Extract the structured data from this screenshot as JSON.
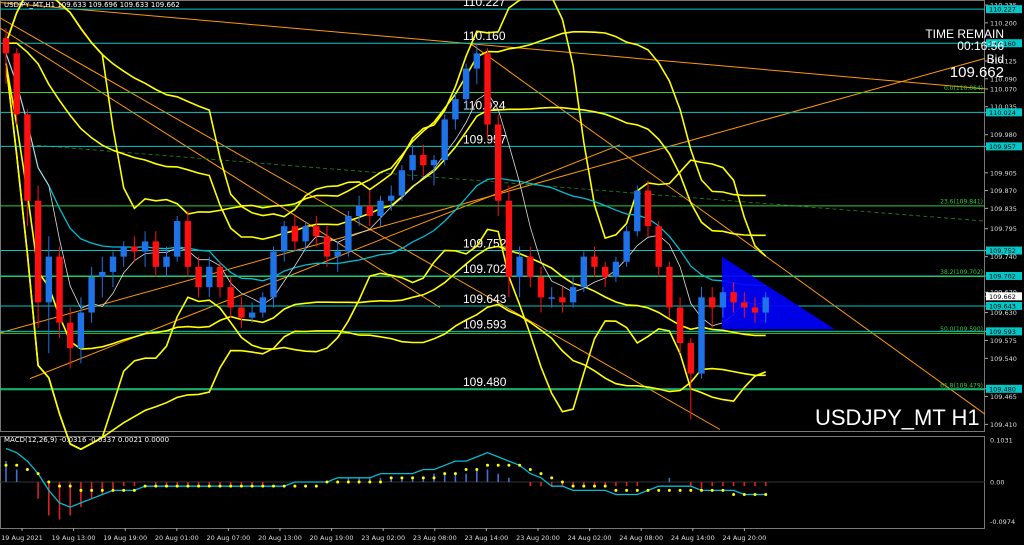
{
  "header": {
    "symbol_line": "USDJPY_MT,H1  109.633 109.696 109.633 109.662",
    "macd_label": "MACD(12,26,9) -0.0316 -0.0337 0.0021 0.0000"
  },
  "info_panel": {
    "time_label": "TIME REMAIN",
    "time_value": "00:16:56",
    "bid_label": "Bid",
    "bid_value": "109.662"
  },
  "watermark": "USDJPY_MT H1",
  "colors": {
    "background": "#000000",
    "bull": "#1e73e8",
    "bear": "#ff1010",
    "band": "#ffff00",
    "hline": "#00c8c8",
    "trend": "#ff9900",
    "fib": "#32cd32",
    "triangle": "#0000ff"
  },
  "chart_data": {
    "type": "candlestick",
    "symbol": "USDJPY_MT",
    "timeframe": "H1",
    "ylim": [
      109.395,
      110.245
    ],
    "y_ticks": [
      "110.235",
      "110.200",
      "110.160",
      "110.125",
      "110.090",
      "110.070",
      "110.035",
      "110.024",
      "109.980",
      "109.957",
      "109.905",
      "109.870",
      "109.835",
      "109.795",
      "109.752",
      "109.740",
      "109.702",
      "109.670",
      "109.662",
      "109.643",
      "109.630",
      "109.593",
      "109.575",
      "109.540",
      "109.480",
      "109.465",
      "109.410"
    ],
    "x_ticks": [
      "19 Aug 2021",
      "19 Aug 13:00",
      "19 Aug 19:00",
      "20 Aug 01:00",
      "20 Aug 07:00",
      "20 Aug 13:00",
      "20 Aug 19:00",
      "23 Aug 02:00",
      "23 Aug 08:00",
      "23 Aug 14:00",
      "23 Aug 20:00",
      "24 Aug 02:00",
      "24 Aug 08:00",
      "24 Aug 14:00",
      "24 Aug 20:00"
    ],
    "horizontal_levels": [
      {
        "price": 110.227,
        "label": "110.227"
      },
      {
        "price": 110.16,
        "label": "110.160"
      },
      {
        "price": 110.024,
        "label": "110.024"
      },
      {
        "price": 109.957,
        "label": "109.957"
      },
      {
        "price": 109.752,
        "label": "109.752"
      },
      {
        "price": 109.702,
        "label": "109.702"
      },
      {
        "price": 109.643,
        "label": "109.643"
      },
      {
        "price": 109.593,
        "label": "109.593"
      },
      {
        "price": 109.48,
        "label": "109.480"
      }
    ],
    "fib_levels": [
      {
        "price": 110.064,
        "label": "0.0(110.064)"
      },
      {
        "price": 109.841,
        "label": "23.6(109.841)"
      },
      {
        "price": 109.702,
        "label": "38.2(109.702)"
      },
      {
        "price": 109.59,
        "label": "50.0(109.590)"
      },
      {
        "price": 109.479,
        "label": "61.8(109.479)"
      }
    ],
    "price_badges": [
      "110.227",
      "110.160",
      "110.024",
      "109.957",
      "109.752",
      "109.702",
      "109.662",
      "109.643",
      "109.593",
      "109.480"
    ],
    "current_price": 109.662,
    "candles": [
      {
        "o": 110.17,
        "h": 110.19,
        "l": 110.08,
        "c": 110.14
      },
      {
        "o": 110.14,
        "h": 110.15,
        "l": 110.0,
        "c": 110.02
      },
      {
        "o": 110.02,
        "h": 110.03,
        "l": 109.8,
        "c": 109.85
      },
      {
        "o": 109.85,
        "h": 109.88,
        "l": 109.6,
        "c": 109.65
      },
      {
        "o": 109.65,
        "h": 109.78,
        "l": 109.55,
        "c": 109.74
      },
      {
        "o": 109.74,
        "h": 109.76,
        "l": 109.58,
        "c": 109.61
      },
      {
        "o": 109.61,
        "h": 109.64,
        "l": 109.52,
        "c": 109.56
      },
      {
        "o": 109.56,
        "h": 109.66,
        "l": 109.53,
        "c": 109.63
      },
      {
        "o": 109.63,
        "h": 109.72,
        "l": 109.61,
        "c": 109.7
      },
      {
        "o": 109.7,
        "h": 109.74,
        "l": 109.66,
        "c": 109.71
      },
      {
        "o": 109.71,
        "h": 109.75,
        "l": 109.68,
        "c": 109.74
      },
      {
        "o": 109.74,
        "h": 109.77,
        "l": 109.72,
        "c": 109.76
      },
      {
        "o": 109.76,
        "h": 109.78,
        "l": 109.73,
        "c": 109.75
      },
      {
        "o": 109.75,
        "h": 109.79,
        "l": 109.72,
        "c": 109.77
      },
      {
        "o": 109.77,
        "h": 109.79,
        "l": 109.7,
        "c": 109.72
      },
      {
        "o": 109.72,
        "h": 109.76,
        "l": 109.7,
        "c": 109.74
      },
      {
        "o": 109.74,
        "h": 109.82,
        "l": 109.73,
        "c": 109.81
      },
      {
        "o": 109.81,
        "h": 109.83,
        "l": 109.7,
        "c": 109.72
      },
      {
        "o": 109.72,
        "h": 109.74,
        "l": 109.66,
        "c": 109.68
      },
      {
        "o": 109.68,
        "h": 109.74,
        "l": 109.66,
        "c": 109.72
      },
      {
        "o": 109.72,
        "h": 109.73,
        "l": 109.66,
        "c": 109.68
      },
      {
        "o": 109.68,
        "h": 109.7,
        "l": 109.62,
        "c": 109.64
      },
      {
        "o": 109.64,
        "h": 109.66,
        "l": 109.6,
        "c": 109.62
      },
      {
        "o": 109.62,
        "h": 109.65,
        "l": 109.61,
        "c": 109.63
      },
      {
        "o": 109.63,
        "h": 109.67,
        "l": 109.62,
        "c": 109.66
      },
      {
        "o": 109.66,
        "h": 109.76,
        "l": 109.64,
        "c": 109.75
      },
      {
        "o": 109.75,
        "h": 109.81,
        "l": 109.73,
        "c": 109.8
      },
      {
        "o": 109.8,
        "h": 109.82,
        "l": 109.75,
        "c": 109.77
      },
      {
        "o": 109.77,
        "h": 109.81,
        "l": 109.75,
        "c": 109.8
      },
      {
        "o": 109.8,
        "h": 109.82,
        "l": 109.76,
        "c": 109.78
      },
      {
        "o": 109.78,
        "h": 109.8,
        "l": 109.72,
        "c": 109.74
      },
      {
        "o": 109.74,
        "h": 109.77,
        "l": 109.71,
        "c": 109.75
      },
      {
        "o": 109.75,
        "h": 109.83,
        "l": 109.74,
        "c": 109.82
      },
      {
        "o": 109.82,
        "h": 109.86,
        "l": 109.8,
        "c": 109.84
      },
      {
        "o": 109.84,
        "h": 109.87,
        "l": 109.8,
        "c": 109.82
      },
      {
        "o": 109.82,
        "h": 109.86,
        "l": 109.8,
        "c": 109.85
      },
      {
        "o": 109.85,
        "h": 109.88,
        "l": 109.83,
        "c": 109.86
      },
      {
        "o": 109.86,
        "h": 109.92,
        "l": 109.85,
        "c": 109.91
      },
      {
        "o": 109.91,
        "h": 109.96,
        "l": 109.89,
        "c": 109.94
      },
      {
        "o": 109.94,
        "h": 109.96,
        "l": 109.9,
        "c": 109.92
      },
      {
        "o": 109.92,
        "h": 109.94,
        "l": 109.88,
        "c": 109.93
      },
      {
        "o": 109.93,
        "h": 110.02,
        "l": 109.92,
        "c": 110.01
      },
      {
        "o": 110.01,
        "h": 110.06,
        "l": 109.99,
        "c": 110.05
      },
      {
        "o": 110.05,
        "h": 110.12,
        "l": 110.03,
        "c": 110.11
      },
      {
        "o": 110.11,
        "h": 110.16,
        "l": 110.08,
        "c": 110.14
      },
      {
        "o": 110.14,
        "h": 110.15,
        "l": 109.97,
        "c": 110.0
      },
      {
        "o": 110.0,
        "h": 110.02,
        "l": 109.82,
        "c": 109.85
      },
      {
        "o": 109.85,
        "h": 109.88,
        "l": 109.66,
        "c": 109.7
      },
      {
        "o": 109.7,
        "h": 109.76,
        "l": 109.66,
        "c": 109.74
      },
      {
        "o": 109.74,
        "h": 109.76,
        "l": 109.68,
        "c": 109.7
      },
      {
        "o": 109.7,
        "h": 109.72,
        "l": 109.63,
        "c": 109.66
      },
      {
        "o": 109.66,
        "h": 109.68,
        "l": 109.64,
        "c": 109.66
      },
      {
        "o": 109.66,
        "h": 109.68,
        "l": 109.63,
        "c": 109.65
      },
      {
        "o": 109.65,
        "h": 109.7,
        "l": 109.64,
        "c": 109.68
      },
      {
        "o": 109.68,
        "h": 109.75,
        "l": 109.67,
        "c": 109.74
      },
      {
        "o": 109.74,
        "h": 109.76,
        "l": 109.7,
        "c": 109.72
      },
      {
        "o": 109.72,
        "h": 109.73,
        "l": 109.68,
        "c": 109.7
      },
      {
        "o": 109.7,
        "h": 109.74,
        "l": 109.69,
        "c": 109.73
      },
      {
        "o": 109.73,
        "h": 109.8,
        "l": 109.72,
        "c": 109.79
      },
      {
        "o": 109.79,
        "h": 109.88,
        "l": 109.78,
        "c": 109.87
      },
      {
        "o": 109.87,
        "h": 109.89,
        "l": 109.78,
        "c": 109.8
      },
      {
        "o": 109.8,
        "h": 109.81,
        "l": 109.7,
        "c": 109.72
      },
      {
        "o": 109.72,
        "h": 109.73,
        "l": 109.62,
        "c": 109.64
      },
      {
        "o": 109.64,
        "h": 109.66,
        "l": 109.55,
        "c": 109.57
      },
      {
        "o": 109.57,
        "h": 109.58,
        "l": 109.42,
        "c": 109.51
      },
      {
        "o": 109.51,
        "h": 109.68,
        "l": 109.5,
        "c": 109.66
      },
      {
        "o": 109.66,
        "h": 109.68,
        "l": 109.6,
        "c": 109.64
      },
      {
        "o": 109.64,
        "h": 109.68,
        "l": 109.62,
        "c": 109.67
      },
      {
        "o": 109.67,
        "h": 109.69,
        "l": 109.63,
        "c": 109.65
      },
      {
        "o": 109.65,
        "h": 109.67,
        "l": 109.62,
        "c": 109.64
      },
      {
        "o": 109.64,
        "h": 109.66,
        "l": 109.61,
        "c": 109.63
      },
      {
        "o": 109.63,
        "h": 109.67,
        "l": 109.61,
        "c": 109.66
      }
    ],
    "macd": {
      "label": "MACD(12,26,9)",
      "values": [
        -0.0316,
        -0.0337,
        0.0021,
        0.0
      ],
      "y_ticks": [
        "0.1031",
        "0.00",
        "-0.0974"
      ],
      "ylim": [
        -0.11,
        0.11
      ],
      "histogram": [
        0.05,
        0.03,
        0.0,
        -0.04,
        -0.08,
        -0.09,
        -0.08,
        -0.06,
        -0.04,
        -0.03,
        -0.02,
        -0.01,
        -0.01,
        0.0,
        -0.01,
        -0.01,
        -0.01,
        -0.01,
        -0.01,
        -0.01,
        -0.01,
        -0.01,
        -0.01,
        -0.01,
        -0.01,
        0.0,
        0.0,
        0.0,
        0.0,
        0.0,
        0.0,
        0.0,
        0.01,
        0.01,
        0.01,
        0.01,
        0.01,
        0.01,
        0.01,
        0.01,
        0.02,
        0.02,
        0.02,
        0.02,
        0.03,
        0.03,
        0.02,
        0.01,
        0.0,
        -0.01,
        -0.01,
        -0.01,
        -0.01,
        -0.01,
        -0.01,
        -0.01,
        -0.01,
        -0.01,
        -0.01,
        -0.01,
        0.0,
        0.0,
        0.01,
        0.0,
        -0.01,
        -0.02,
        -0.01,
        -0.01,
        -0.01,
        -0.01,
        -0.01,
        -0.01
      ],
      "signal": [
        0.04,
        0.04,
        0.03,
        0.02,
        0.0,
        -0.01,
        -0.01,
        -0.02,
        -0.02,
        -0.02,
        -0.02,
        -0.02,
        -0.02,
        -0.01,
        -0.01,
        -0.01,
        -0.01,
        -0.01,
        -0.01,
        -0.01,
        -0.01,
        -0.01,
        -0.01,
        -0.01,
        -0.01,
        -0.01,
        -0.01,
        -0.01,
        -0.01,
        -0.01,
        0.0,
        0.0,
        0.0,
        0.0,
        0.0,
        0.0,
        0.01,
        0.01,
        0.01,
        0.01,
        0.01,
        0.02,
        0.02,
        0.03,
        0.03,
        0.04,
        0.04,
        0.04,
        0.04,
        0.03,
        0.02,
        0.01,
        0.0,
        -0.01,
        -0.01,
        -0.01,
        -0.01,
        -0.02,
        -0.02,
        -0.02,
        -0.02,
        -0.02,
        -0.02,
        -0.02,
        -0.02,
        -0.02,
        -0.02,
        -0.02,
        -0.03,
        -0.03,
        -0.03,
        -0.03
      ],
      "main": [
        0.08,
        0.07,
        0.05,
        0.02,
        -0.02,
        -0.05,
        -0.06,
        -0.05,
        -0.04,
        -0.03,
        -0.02,
        -0.02,
        -0.02,
        -0.01,
        -0.01,
        -0.01,
        -0.01,
        -0.01,
        -0.01,
        -0.01,
        -0.01,
        -0.01,
        -0.01,
        -0.01,
        -0.01,
        -0.01,
        -0.01,
        0.0,
        0.0,
        0.0,
        0.0,
        0.01,
        0.01,
        0.01,
        0.01,
        0.02,
        0.02,
        0.02,
        0.02,
        0.03,
        0.03,
        0.04,
        0.05,
        0.05,
        0.06,
        0.07,
        0.06,
        0.05,
        0.04,
        0.02,
        0.01,
        -0.01,
        -0.01,
        -0.02,
        -0.02,
        -0.02,
        -0.02,
        -0.03,
        -0.03,
        -0.03,
        -0.02,
        -0.01,
        -0.01,
        -0.01,
        -0.01,
        -0.02,
        -0.02,
        -0.02,
        -0.02,
        -0.03,
        -0.03,
        -0.03
      ]
    }
  }
}
